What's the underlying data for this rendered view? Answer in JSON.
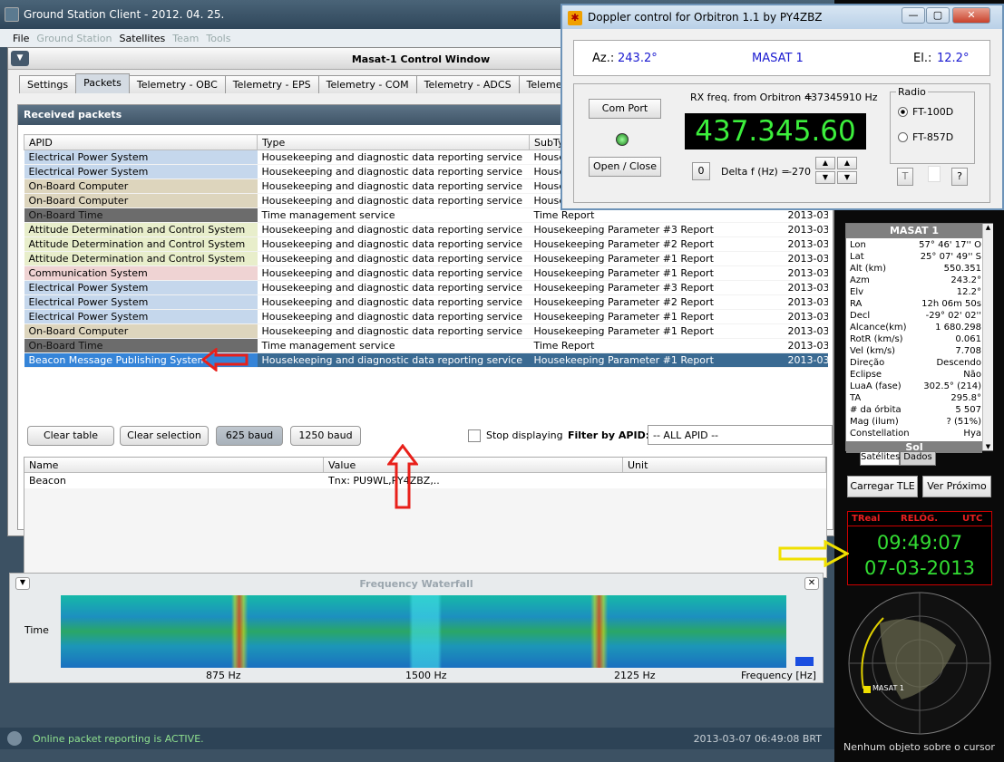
{
  "main_window": {
    "title": "Ground Station Client - 2012. 04. 25.",
    "controls": [
      "—",
      "□",
      "✕"
    ]
  },
  "menu": [
    {
      "label": "File",
      "enabled": true
    },
    {
      "label": "Ground Station",
      "enabled": false
    },
    {
      "label": "Satellites",
      "enabled": true
    },
    {
      "label": "Team",
      "enabled": false
    },
    {
      "label": "Tools",
      "enabled": false
    }
  ],
  "control_window": {
    "title": "Masat-1 Control Window"
  },
  "tabs": [
    "Settings",
    "Packets",
    "Telemetry - OBC",
    "Telemetry - EPS",
    "Telemetry - COM",
    "Telemetry - ADCS",
    "Telemetry - TCS"
  ],
  "active_tab": 1,
  "received": {
    "title": "Received packets",
    "columns": [
      "APID",
      "Type",
      "SubType",
      ""
    ],
    "rows": [
      {
        "apid": "Electrical Power System",
        "type": "Housekeeping and diagnostic data reporting service",
        "subtype": "House",
        "time": "",
        "cls": "c-eps"
      },
      {
        "apid": "Electrical Power System",
        "type": "Housekeeping and diagnostic data reporting service",
        "subtype": "House",
        "time": "",
        "cls": "c-eps"
      },
      {
        "apid": "On-Board Computer",
        "type": "Housekeeping and diagnostic data reporting service",
        "subtype": "House",
        "time": "",
        "cls": "c-obc"
      },
      {
        "apid": "On-Board Computer",
        "type": "Housekeeping and diagnostic data reporting service",
        "subtype": "House",
        "time": "",
        "cls": "c-obc"
      },
      {
        "apid": "On-Board Time",
        "type": "Time management service",
        "subtype": "Time Report",
        "time": "2013-03-",
        "cls": "c-obt"
      },
      {
        "apid": "Attitude Determination and Control System",
        "type": "Housekeeping and diagnostic data reporting service",
        "subtype": "Housekeeping Parameter #3 Report",
        "time": "2013-03-",
        "cls": "c-adcs"
      },
      {
        "apid": "Attitude Determination and Control System",
        "type": "Housekeeping and diagnostic data reporting service",
        "subtype": "Housekeeping Parameter #2 Report",
        "time": "2013-03-",
        "cls": "c-adcs"
      },
      {
        "apid": "Attitude Determination and Control System",
        "type": "Housekeeping and diagnostic data reporting service",
        "subtype": "Housekeeping Parameter #1 Report",
        "time": "2013-03-",
        "cls": "c-adcs"
      },
      {
        "apid": "Communication System",
        "type": "Housekeeping and diagnostic data reporting service",
        "subtype": "Housekeeping Parameter #1 Report",
        "time": "2013-03-",
        "cls": "c-com"
      },
      {
        "apid": "Electrical Power System",
        "type": "Housekeeping and diagnostic data reporting service",
        "subtype": "Housekeeping Parameter #3 Report",
        "time": "2013-03-",
        "cls": "c-eps"
      },
      {
        "apid": "Electrical Power System",
        "type": "Housekeeping and diagnostic data reporting service",
        "subtype": "Housekeeping Parameter #2 Report",
        "time": "2013-03-",
        "cls": "c-eps"
      },
      {
        "apid": "Electrical Power System",
        "type": "Housekeeping and diagnostic data reporting service",
        "subtype": "Housekeeping Parameter #1 Report",
        "time": "2013-03-",
        "cls": "c-eps"
      },
      {
        "apid": "On-Board Computer",
        "type": "Housekeeping and diagnostic data reporting service",
        "subtype": "Housekeeping Parameter #1 Report",
        "time": "2013-03-",
        "cls": "c-obc"
      },
      {
        "apid": "On-Board Time",
        "type": "Time management service",
        "subtype": "Time Report",
        "time": "2013-03-",
        "cls": "c-obt"
      },
      {
        "apid": "Beacon Message Publishing System",
        "type": "Housekeeping and diagnostic data reporting service",
        "subtype": "Housekeeping Parameter #1 Report",
        "time": "2013-03-",
        "cls": "sel"
      }
    ]
  },
  "buttons": {
    "clear_table": "Clear table",
    "clear_selection": "Clear selection",
    "baud625": "625 baud",
    "baud1250": "1250 baud",
    "stop_displaying": "Stop displaying",
    "filter_label": "Filter by APID:",
    "filter_value": "-- ALL APID --"
  },
  "values": {
    "columns": [
      "Name",
      "Value",
      "Unit"
    ],
    "rows": [
      {
        "name": "Beacon",
        "value": "Tnx: PU9WL,PY4ZBZ,..",
        "unit": ""
      }
    ]
  },
  "waterfall": {
    "title": "Frequency Waterfall",
    "time_label": "Time",
    "ticks": [
      "875 Hz",
      "1500 Hz",
      "2125 Hz"
    ],
    "axis_label": "Frequency [Hz]"
  },
  "status": {
    "text": "Online packet reporting is ACTIVE.",
    "time": "2013-03-07 06:49:08 BRT"
  },
  "doppler": {
    "title": "Doppler control for Orbitron  1.1     by  PY4ZBZ",
    "az_label": "Az.:",
    "az": "243.2°",
    "sat": "MASAT 1",
    "el_label": "El.:",
    "el": "12.2°",
    "com_port": "Com Port",
    "open_close": "Open / Close",
    "rx_label": "RX freq. from Orbitron =",
    "rx_value": "437345910 Hz",
    "freq": "437.345.60",
    "zero": "0",
    "delta_label": "Delta f (Hz) =",
    "delta": "-270",
    "radio_label": "Radio",
    "radio1": "FT-100D",
    "radio2": "FT-857D",
    "t_btn": "T",
    "q_btn": "?"
  },
  "orbitron": {
    "sat": "MASAT 1",
    "rows": [
      [
        "Lon",
        "57° 46' 17'' O"
      ],
      [
        "Lat",
        "25° 07' 49'' S"
      ],
      [
        "Alt (km)",
        "550.351"
      ],
      [
        "Azm",
        "243.2°"
      ],
      [
        "Elv",
        "12.2°"
      ],
      [
        "RA",
        "12h 06m 50s"
      ],
      [
        "Decl",
        "-29° 02' 02''"
      ],
      [
        "Alcance(km)",
        "1 680.298"
      ],
      [
        "RotR (km/s)",
        "0.061"
      ],
      [
        "Vel (km/s)",
        "7.708"
      ],
      [
        "Direção",
        "Descendo"
      ],
      [
        "Eclipse",
        "Não"
      ],
      [
        "LuaA (fase)",
        "302.5° (214)"
      ],
      [
        "TA",
        "295.8°"
      ],
      [
        "# da órbita",
        "5 507"
      ],
      [
        "Mag (ilum)",
        "? (51%)"
      ],
      [
        "Constellation",
        "Hya"
      ]
    ],
    "sol": "Sol",
    "tab1": "Satélites",
    "tab2": "Dados",
    "load_tle": "Carregar TLE",
    "next": "Ver Próximo",
    "clock_labels": [
      "TReal",
      "RELÓG.",
      "UTC"
    ],
    "clock_time": "09:49:07",
    "clock_date": "07-03-2013",
    "radar_sat": "MASAT 1",
    "hint": "Nenhum objeto sobre o cursor"
  },
  "colors": {
    "arrow_red": "#e8201a",
    "arrow_yellow": "#f0e000",
    "freq_green": "#3cef3c"
  }
}
